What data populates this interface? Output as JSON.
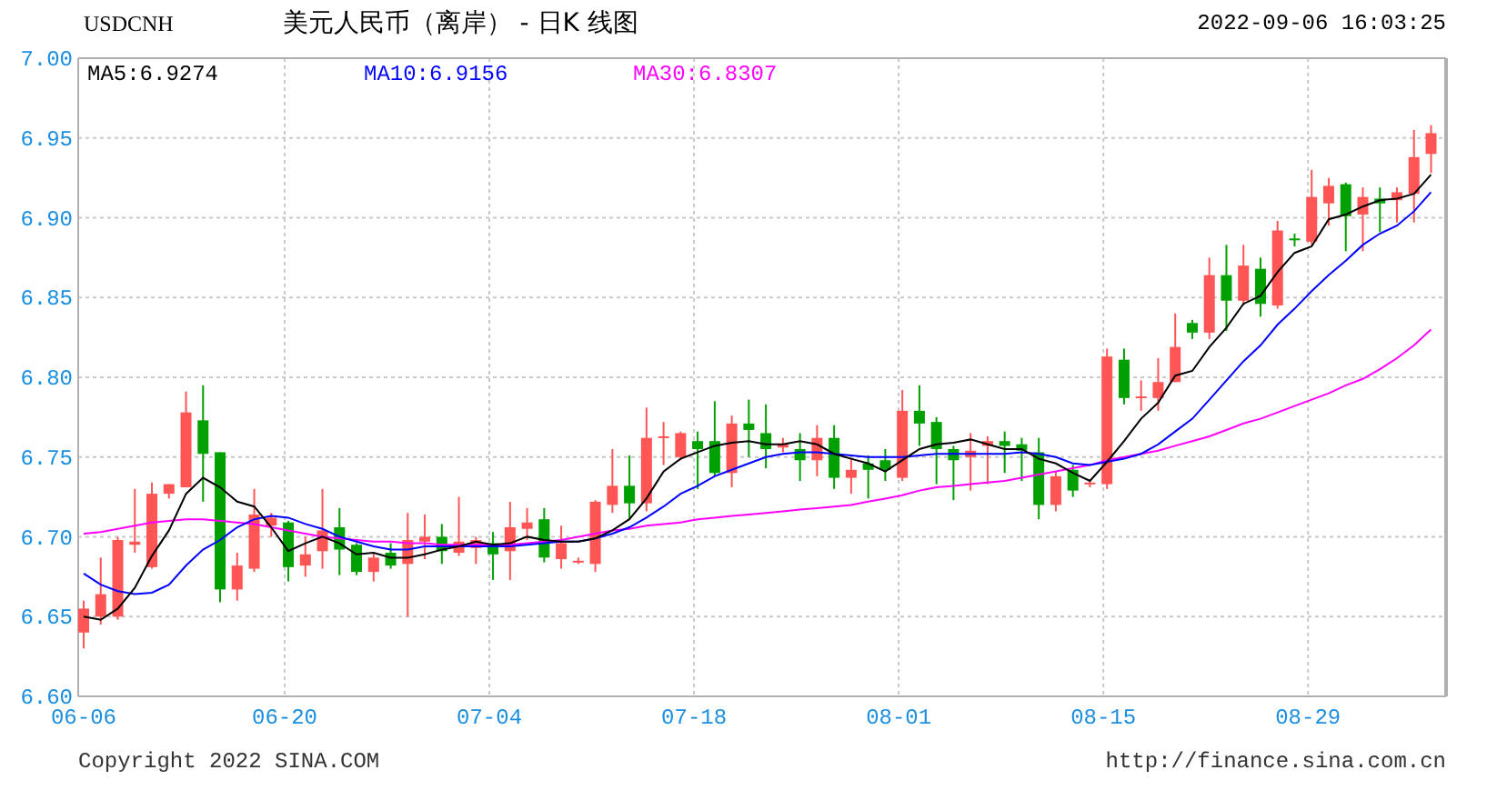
{
  "header": {
    "symbol": "USDCNH",
    "title": "美元人民币（离岸） - 日K 线图",
    "timestamp": "2022-09-06 16:03:25"
  },
  "chart": {
    "legend": [
      ":6.9274",
      ":6.9156",
      ":6.8307"
    ],
    "chart_data": {
      "type": "candlestick",
      "grid": true,
      "ylim": [
        6.6,
        7.0
      ],
      "yticks": [
        {
          "value": 6.6,
          "label": "6.60"
        },
        {
          "value": 6.65,
          "label": "6.65"
        },
        {
          "value": 6.7,
          "label": "6.70"
        },
        {
          "value": 6.75,
          "label": "6.75"
        },
        {
          "value": 6.8,
          "label": "6.80"
        },
        {
          "value": 6.85,
          "label": "6.85"
        },
        {
          "value": 6.9,
          "label": "6.90"
        },
        {
          "value": 6.95,
          "label": "6.95"
        },
        {
          "value": 7.0,
          "label": "7.00"
        }
      ],
      "categories": [
        "06-06",
        null,
        null,
        null,
        null,
        null,
        null,
        null,
        null,
        null,
        null,
        null,
        "06-20",
        null,
        null,
        null,
        null,
        null,
        null,
        null,
        null,
        null,
        null,
        null,
        "07-04",
        null,
        null,
        null,
        null,
        null,
        null,
        null,
        null,
        null,
        null,
        null,
        "07-18",
        null,
        null,
        null,
        null,
        null,
        null,
        null,
        null,
        null,
        null,
        null,
        "08-01",
        null,
        null,
        null,
        null,
        null,
        null,
        null,
        null,
        null,
        null,
        null,
        "08-15",
        null,
        null,
        null,
        null,
        null,
        null,
        null,
        null,
        null,
        null,
        null,
        "08-29",
        null,
        null,
        null,
        null,
        null,
        null,
        null
      ],
      "ohlc": [
        [
          6.64,
          6.66,
          6.63,
          6.655
        ],
        [
          6.65,
          6.687,
          6.645,
          6.664
        ],
        [
          6.65,
          6.7,
          6.648,
          6.698
        ],
        [
          6.695,
          6.73,
          6.69,
          6.697
        ],
        [
          6.681,
          6.734,
          6.68,
          6.727
        ],
        [
          6.727,
          6.733,
          6.724,
          6.733
        ],
        [
          6.731,
          6.791,
          6.731,
          6.778
        ],
        [
          6.773,
          6.795,
          6.722,
          6.752
        ],
        [
          6.753,
          6.753,
          6.659,
          6.667
        ],
        [
          6.667,
          6.69,
          6.66,
          6.682
        ],
        [
          6.68,
          6.73,
          6.678,
          6.714
        ],
        [
          6.707,
          6.715,
          6.7,
          6.712
        ],
        [
          6.709,
          6.71,
          6.672,
          6.681
        ],
        [
          6.682,
          6.7,
          6.675,
          6.689
        ],
        [
          6.691,
          6.73,
          6.68,
          6.704
        ],
        [
          6.706,
          6.718,
          6.676,
          6.692
        ],
        [
          6.695,
          6.696,
          6.676,
          6.678
        ],
        [
          6.678,
          6.69,
          6.672,
          6.687
        ],
        [
          6.69,
          6.696,
          6.68,
          6.682
        ],
        [
          6.683,
          6.715,
          6.65,
          6.698
        ],
        [
          6.697,
          6.714,
          6.686,
          6.7
        ],
        [
          6.7,
          6.708,
          6.683,
          6.691
        ],
        [
          6.69,
          6.725,
          6.688,
          6.697
        ],
        [
          6.693,
          6.7,
          6.683,
          6.698
        ],
        [
          6.696,
          6.703,
          6.673,
          6.689
        ],
        [
          6.691,
          6.722,
          6.673,
          6.706
        ],
        [
          6.705,
          6.718,
          6.698,
          6.709
        ],
        [
          6.711,
          6.718,
          6.684,
          6.687
        ],
        [
          6.686,
          6.707,
          6.68,
          6.696
        ],
        [
          6.684,
          6.687,
          6.683,
          6.685
        ],
        [
          6.683,
          6.723,
          6.678,
          6.722
        ],
        [
          6.72,
          6.755,
          6.715,
          6.732
        ],
        [
          6.732,
          6.751,
          6.711,
          6.721
        ],
        [
          6.721,
          6.781,
          6.716,
          6.762
        ],
        [
          6.762,
          6.772,
          6.745,
          6.763
        ],
        [
          6.75,
          6.766,
          6.748,
          6.765
        ],
        [
          6.76,
          6.766,
          6.73,
          6.755
        ],
        [
          6.76,
          6.785,
          6.738,
          6.74
        ],
        [
          6.74,
          6.776,
          6.731,
          6.771
        ],
        [
          6.771,
          6.786,
          6.75,
          6.767
        ],
        [
          6.765,
          6.783,
          6.743,
          6.755
        ],
        [
          6.756,
          6.762,
          6.753,
          6.758
        ],
        [
          6.755,
          6.765,
          6.735,
          6.748
        ],
        [
          6.748,
          6.77,
          6.738,
          6.762
        ],
        [
          6.762,
          6.77,
          6.73,
          6.737
        ],
        [
          6.737,
          6.749,
          6.727,
          6.742
        ],
        [
          6.746,
          6.751,
          6.724,
          6.742
        ],
        [
          6.748,
          6.755,
          6.735,
          6.742
        ],
        [
          6.737,
          6.792,
          6.735,
          6.779
        ],
        [
          6.779,
          6.795,
          6.757,
          6.771
        ],
        [
          6.772,
          6.775,
          6.733,
          6.755
        ],
        [
          6.755,
          6.757,
          6.723,
          6.748
        ],
        [
          6.75,
          6.765,
          6.729,
          6.754
        ],
        [
          6.757,
          6.763,
          6.733,
          6.76
        ],
        [
          6.76,
          6.766,
          6.74,
          6.757
        ],
        [
          6.758,
          6.762,
          6.735,
          6.754
        ],
        [
          6.753,
          6.762,
          6.711,
          6.72
        ],
        [
          6.72,
          6.741,
          6.716,
          6.738
        ],
        [
          6.742,
          6.745,
          6.725,
          6.729
        ],
        [
          6.733,
          6.736,
          6.731,
          6.734
        ],
        [
          6.733,
          6.818,
          6.73,
          6.813
        ],
        [
          6.811,
          6.818,
          6.783,
          6.787
        ],
        [
          6.787,
          6.798,
          6.779,
          6.788
        ],
        [
          6.787,
          6.812,
          6.779,
          6.797
        ],
        [
          6.797,
          6.84,
          6.797,
          6.819
        ],
        [
          6.834,
          6.836,
          6.824,
          6.828
        ],
        [
          6.828,
          6.875,
          6.824,
          6.864
        ],
        [
          6.864,
          6.883,
          6.829,
          6.848
        ],
        [
          6.848,
          6.883,
          6.845,
          6.87
        ],
        [
          6.868,
          6.875,
          6.838,
          6.846
        ],
        [
          6.845,
          6.898,
          6.843,
          6.892
        ],
        [
          6.887,
          6.89,
          6.882,
          6.886
        ],
        [
          6.885,
          6.93,
          6.883,
          6.913
        ],
        [
          6.909,
          6.925,
          6.895,
          6.92
        ],
        [
          6.921,
          6.922,
          6.879,
          6.901
        ],
        [
          6.902,
          6.919,
          6.879,
          6.913
        ],
        [
          6.912,
          6.919,
          6.891,
          6.909
        ],
        [
          6.911,
          6.919,
          6.897,
          6.916
        ],
        [
          6.915,
          6.955,
          6.897,
          6.938
        ],
        [
          6.94,
          6.958,
          6.928,
          6.953
        ]
      ],
      "series": [
        {
          "name": "MA5",
          "type": "line",
          "color": "#000000",
          "values": [
            6.65,
            6.648,
            6.655,
            6.668,
            6.688,
            6.704,
            6.727,
            6.737,
            6.731,
            6.722,
            6.719,
            6.706,
            6.691,
            6.696,
            6.7,
            6.696,
            6.689,
            6.69,
            6.687,
            6.687,
            6.689,
            6.692,
            6.694,
            6.697,
            6.695,
            6.696,
            6.7,
            6.698,
            6.697,
            6.697,
            6.699,
            6.704,
            6.711,
            6.724,
            6.741,
            6.749,
            6.753,
            6.757,
            6.759,
            6.76,
            6.758,
            6.758,
            6.76,
            6.758,
            6.752,
            6.749,
            6.746,
            6.741,
            6.748,
            6.755,
            6.758,
            6.759,
            6.761,
            6.758,
            6.755,
            6.755,
            6.749,
            6.746,
            6.74,
            6.735,
            6.747,
            6.76,
            6.774,
            6.784,
            6.801,
            6.804,
            6.819,
            6.831,
            6.846,
            6.851,
            6.866,
            6.878,
            6.882,
            6.899,
            6.902,
            6.907,
            6.911,
            6.912,
            6.915,
            6.927
          ]
        },
        {
          "name": "MA10",
          "type": "line",
          "color": "#0000ff",
          "values": [
            6.677,
            6.67,
            6.666,
            6.664,
            6.665,
            6.67,
            6.682,
            6.692,
            6.698,
            6.706,
            6.711,
            6.713,
            6.712,
            6.708,
            6.705,
            6.7,
            6.697,
            6.694,
            6.692,
            6.692,
            6.694,
            6.694,
            6.694,
            6.694,
            6.694,
            6.694,
            6.695,
            6.696,
            6.697,
            6.697,
            6.699,
            6.702,
            6.706,
            6.712,
            6.719,
            6.727,
            6.732,
            6.738,
            6.742,
            6.746,
            6.75,
            6.752,
            6.753,
            6.753,
            6.752,
            6.751,
            6.75,
            6.75,
            6.75,
            6.751,
            6.752,
            6.752,
            6.752,
            6.752,
            6.752,
            6.753,
            6.752,
            6.75,
            6.746,
            6.745,
            6.747,
            6.749,
            6.752,
            6.758,
            6.766,
            6.774,
            6.786,
            6.798,
            6.81,
            6.82,
            6.833,
            6.843,
            6.854,
            6.864,
            6.873,
            6.883,
            6.89,
            6.895,
            6.904,
            6.916
          ]
        },
        {
          "name": "MA30",
          "type": "line",
          "color": "#ff00ff",
          "values": [
            6.702,
            6.703,
            6.705,
            6.707,
            6.709,
            6.71,
            6.711,
            6.711,
            6.71,
            6.709,
            6.708,
            6.706,
            6.704,
            6.702,
            6.7,
            6.699,
            6.698,
            6.697,
            6.697,
            6.696,
            6.696,
            6.695,
            6.695,
            6.695,
            6.695,
            6.695,
            6.696,
            6.697,
            6.698,
            6.7,
            6.702,
            6.704,
            6.705,
            6.707,
            6.708,
            6.709,
            6.711,
            6.712,
            6.713,
            6.714,
            6.715,
            6.716,
            6.717,
            6.718,
            6.719,
            6.72,
            6.722,
            6.724,
            6.726,
            6.729,
            6.731,
            6.732,
            6.733,
            6.734,
            6.735,
            6.737,
            6.739,
            6.741,
            6.743,
            6.745,
            6.748,
            6.75,
            6.752,
            6.754,
            6.757,
            6.76,
            6.763,
            6.767,
            6.771,
            6.774,
            6.778,
            6.782,
            6.786,
            6.79,
            6.795,
            6.799,
            6.805,
            6.812,
            6.82,
            6.83
          ]
        }
      ]
    }
  },
  "footer": {
    "copyright": "Copyright 2022 SINA.COM",
    "url": "http://finance.sina.com.cn"
  }
}
